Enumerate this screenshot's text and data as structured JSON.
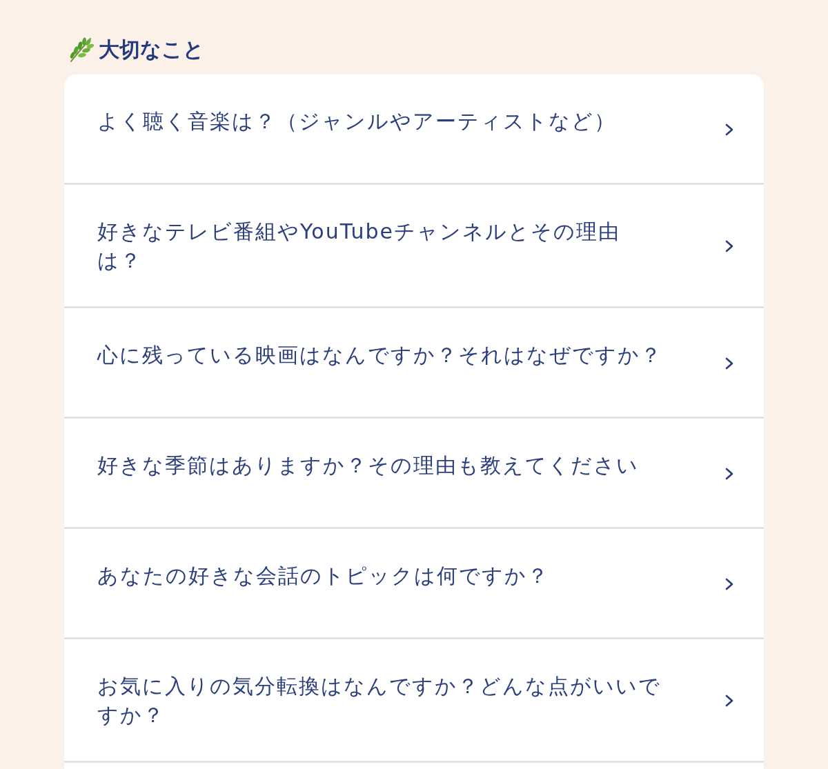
{
  "section": {
    "title": "大切なこと"
  },
  "questions": [
    {
      "text": "よく聴く音楽は？（ジャンルやアーティストなど）"
    },
    {
      "text": "好きなテレビ番組やYouTubeチャンネルとその理由は？"
    },
    {
      "text": "心に残っている映画はなんですか？それはなぜですか？"
    },
    {
      "text": "好きな季節はありますか？その理由も教えてください"
    },
    {
      "text": "あなたの好きな会話のトピックは何ですか？"
    },
    {
      "text": "お気に入りの気分転換はなんですか？どんな点がいいですか？"
    }
  ]
}
